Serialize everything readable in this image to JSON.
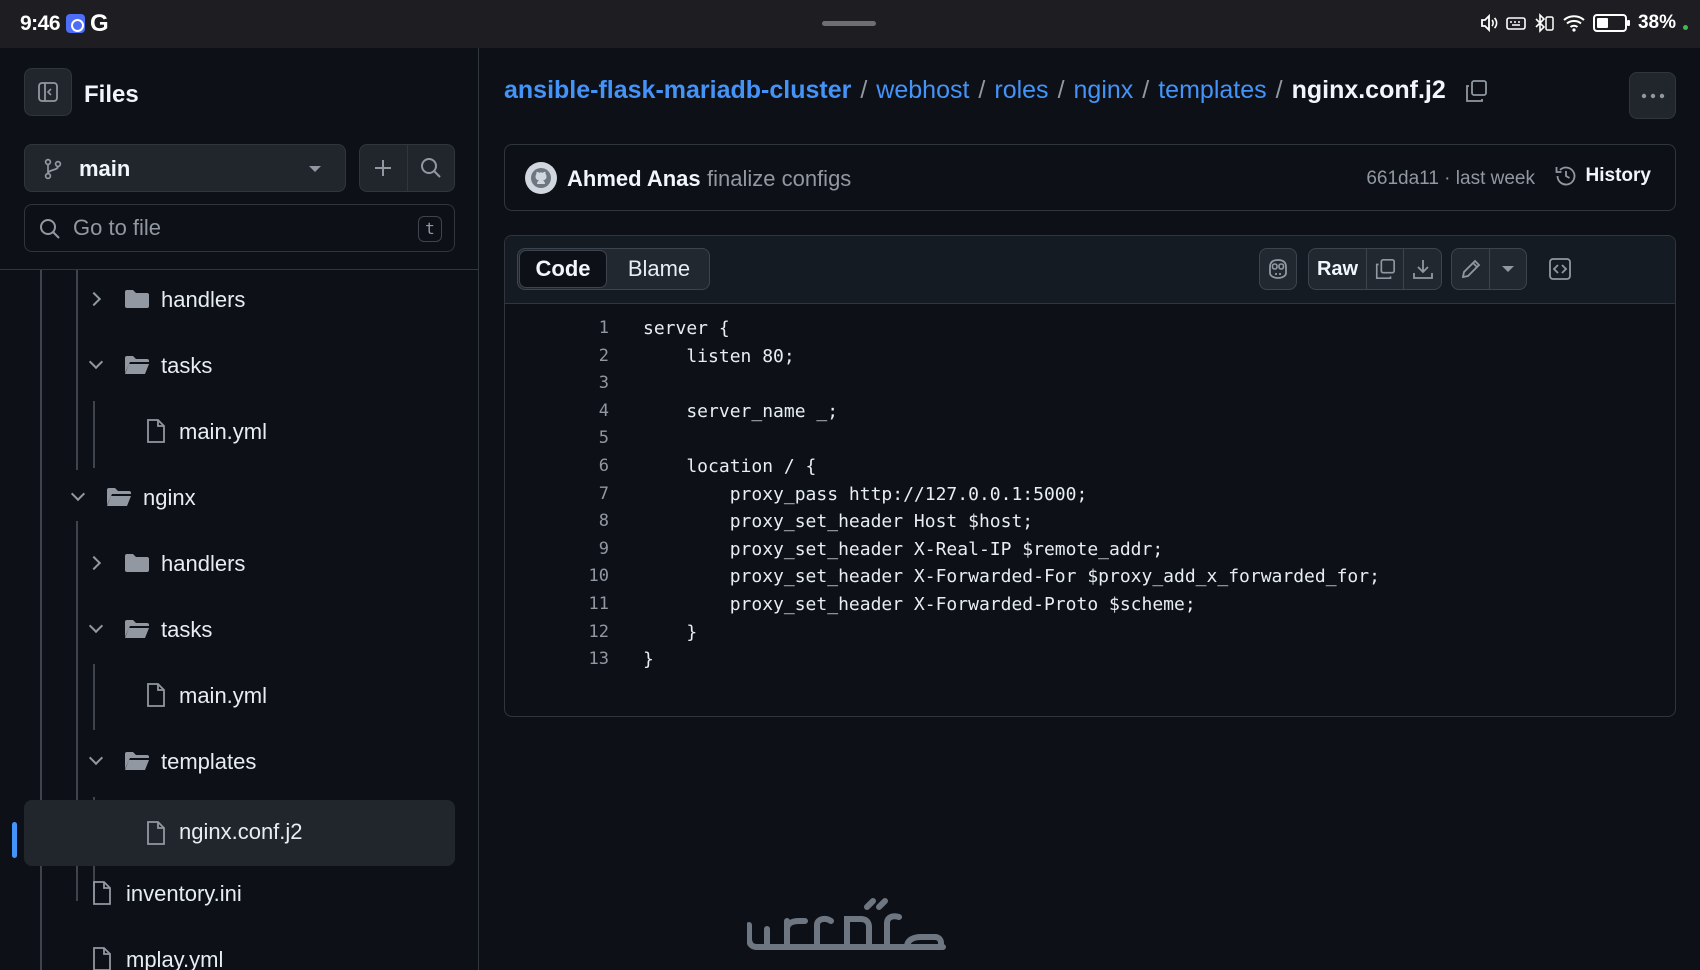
{
  "status_bar": {
    "time": "9:46",
    "battery_percent": "38%",
    "icons": [
      "app-icon",
      "google-icon",
      "volume-icon",
      "keyboard-icon",
      "bluetooth-icon",
      "wifi-icon",
      "battery-icon"
    ]
  },
  "sidebar": {
    "title": "Files",
    "branch": "main",
    "search_placeholder": "Go to file",
    "search_shortcut": "t",
    "tree": [
      {
        "label": "handlers",
        "type": "folder",
        "expanded": false
      },
      {
        "label": "tasks",
        "type": "folder",
        "expanded": true
      },
      {
        "label": "main.yml",
        "type": "file"
      },
      {
        "label": "nginx",
        "type": "folder",
        "expanded": true
      },
      {
        "label": "handlers",
        "type": "folder",
        "expanded": false
      },
      {
        "label": "tasks",
        "type": "folder",
        "expanded": true
      },
      {
        "label": "main.yml",
        "type": "file"
      },
      {
        "label": "templates",
        "type": "folder",
        "expanded": true
      },
      {
        "label": "nginx.conf.j2",
        "type": "file",
        "selected": true
      },
      {
        "label": "inventory.ini",
        "type": "file"
      },
      {
        "label": "mplay.yml",
        "type": "file"
      }
    ]
  },
  "breadcrumb": {
    "repo": "ansible-flask-mariadb-cluster",
    "parts": [
      "webhost",
      "roles",
      "nginx",
      "templates"
    ],
    "separator": "/",
    "current": "nginx.conf.j2"
  },
  "commit": {
    "author": "Ahmed Anas",
    "message": "finalize configs",
    "meta": "661da11 · last week",
    "history_label": "History"
  },
  "file_header": {
    "tab_code": "Code",
    "tab_blame": "Blame",
    "raw_label": "Raw"
  },
  "code": {
    "lines": [
      {
        "n": "1",
        "text": "server {"
      },
      {
        "n": "2",
        "text": "    listen 80;"
      },
      {
        "n": "3",
        "text": ""
      },
      {
        "n": "4",
        "text": "    server_name _;"
      },
      {
        "n": "5",
        "text": ""
      },
      {
        "n": "6",
        "text": "    location / {"
      },
      {
        "n": "7",
        "text": "        proxy_pass http://127.0.0.1:5000;"
      },
      {
        "n": "8",
        "text": "        proxy_set_header Host $host;"
      },
      {
        "n": "9",
        "text": "        proxy_set_header X-Real-IP $remote_addr;"
      },
      {
        "n": "10",
        "text": "        proxy_set_header X-Forwarded-For $proxy_add_x_forwarded_for;"
      },
      {
        "n": "11",
        "text": "        proxy_set_header X-Forwarded-Proto $scheme;"
      },
      {
        "n": "12",
        "text": "    }"
      },
      {
        "n": "13",
        "text": "}"
      }
    ]
  },
  "colors": {
    "background": "#0d1117",
    "link": "#4493f8",
    "border": "#30363d",
    "muted": "#9198a1"
  }
}
